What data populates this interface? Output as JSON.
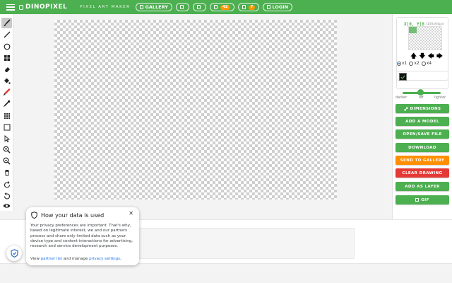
{
  "header": {
    "logo_text": "DINOPIXEL",
    "tagline": "PIXEL ART MAKER",
    "gallery_label": "GALLERY",
    "pill2_label": "",
    "pill3_label": "",
    "likes_count": "42",
    "notifications_count": "7",
    "login_label": "LOGIN",
    "bar_color": "#4caf50"
  },
  "toolbar": {
    "tools": [
      "brush",
      "line",
      "circle",
      "grid-fill",
      "eraser",
      "bucket-fill",
      "color-picker",
      "eyedropper",
      "pattern",
      "rectangle-select",
      "move-cursor",
      "zoom-in",
      "zoom-out",
      "trash",
      "undo",
      "redo",
      "visibility"
    ]
  },
  "preview": {
    "coords": "X|0, Y|0",
    "dims": "(100x64px)",
    "zoom_options": [
      "x1",
      "x2",
      "x4"
    ],
    "zoom_selected": "x1"
  },
  "color": {
    "current": "#111111",
    "darker_label": "darker",
    "off_label": "off",
    "lighter_label": "lighter"
  },
  "actions": {
    "dimensions": "DIMENSIONS",
    "add_model": "ADD A MODEL",
    "open_save": "OPEN/SAVE FILE",
    "download": "DOWNLOAD",
    "send_gallery": "SEND TO GALLERY",
    "clear_drawing": "CLEAR DRAWING",
    "add_layer": "ADD AS LAYER",
    "gif": "GIF"
  },
  "privacy": {
    "title": "How your data is used",
    "body": "Your privacy preferences are important. That's why, based on legitimate interest, we and our partners process and share only limited data such as your device type and content interactions for advertising, research and service development purposes.",
    "footer_prefix": "View",
    "partner_link": "partner list",
    "footer_mid": "and manage",
    "settings_link": "privacy settings",
    "footer_end": "."
  }
}
